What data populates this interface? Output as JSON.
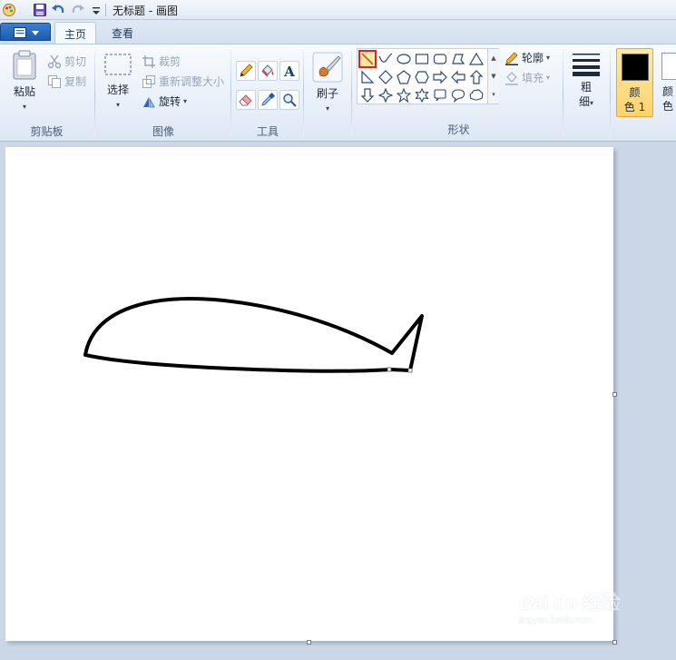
{
  "window": {
    "title": "无标题 - 画图"
  },
  "quick_access": {
    "icons": [
      "save-icon",
      "undo-icon",
      "redo-icon",
      "customize-icon"
    ]
  },
  "tabs": [
    {
      "label": "主页",
      "active": true
    },
    {
      "label": "查看",
      "active": false
    }
  ],
  "ribbon": {
    "clipboard": {
      "group_label": "剪贴板",
      "paste_label": "粘贴",
      "cut_label": "剪切",
      "copy_label": "复制"
    },
    "image": {
      "group_label": "图像",
      "select_label": "选择",
      "crop_label": "裁剪",
      "resize_label": "重新调整大小",
      "rotate_label": "旋转"
    },
    "tools": {
      "group_label": "工具",
      "icons": [
        "pencil-icon",
        "fill-icon",
        "text-icon",
        "eraser-icon",
        "color-picker-icon",
        "magnifier-icon"
      ]
    },
    "brushes": {
      "label": "刷子"
    },
    "shapes": {
      "group_label": "形状",
      "outline_label": "轮廓",
      "fill_label": "填充",
      "selected_shape": "line",
      "items": [
        "line",
        "curve",
        "oval",
        "rectangle",
        "rounded-rectangle",
        "polygon",
        "triangle",
        "right-triangle",
        "diamond",
        "pentagon",
        "hexagon",
        "right-arrow",
        "left-arrow",
        "up-arrow",
        "down-arrow",
        "four-point-star",
        "five-point-star",
        "six-point-star",
        "rounded-callout",
        "oval-callout",
        "cloud-callout"
      ]
    },
    "size": {
      "label_line1": "粗",
      "label_line2": "细"
    },
    "colors": {
      "color1_line1": "颜",
      "color1_line2": "色 1",
      "color1_value": "#000000",
      "color2_line1": "颜",
      "color2_line2": "色",
      "color2_value": "#ffffff",
      "highlight": "#ffd36c"
    }
  },
  "canvas": {
    "background": "#ffffff",
    "drawing": "black-outline-shape",
    "stroke_color": "#000000"
  },
  "watermark": {
    "text": "Bai du 经验",
    "subtext": "jingyan.baidu.com"
  }
}
